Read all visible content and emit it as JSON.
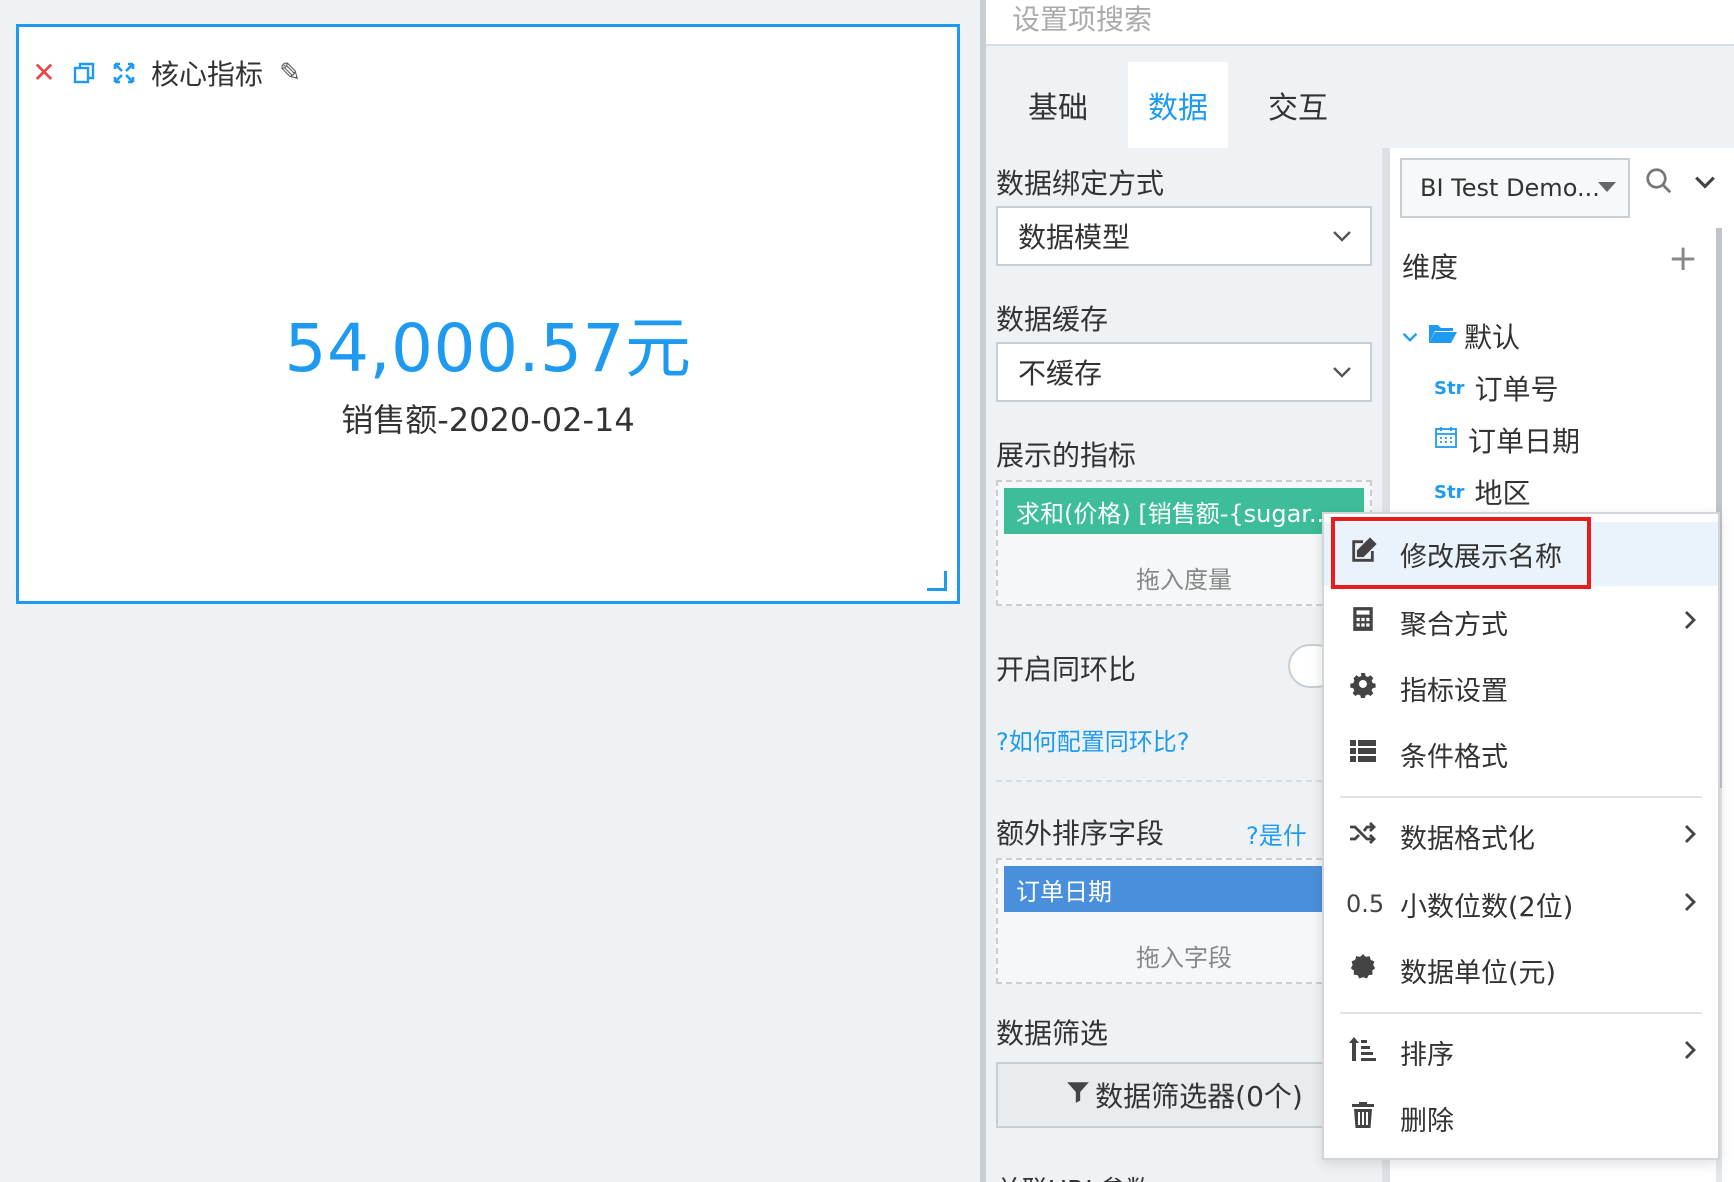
{
  "widget": {
    "title": "核心指标",
    "kpi_value": "54,000.57元",
    "kpi_label": "销售额-2020-02-14"
  },
  "panel": {
    "search_placeholder": "设置项搜索",
    "tabs": [
      {
        "label": "基础",
        "active": false
      },
      {
        "label": "数据",
        "active": true
      },
      {
        "label": "交互",
        "active": false
      }
    ],
    "binding_mode": {
      "label": "数据绑定方式",
      "value": "数据模型"
    },
    "cache": {
      "label": "数据缓存",
      "value": "不缓存"
    },
    "metrics": {
      "label": "展示的指标",
      "chip": "求和(价格) [销售额-{sugar...",
      "hint": "拖入度量"
    },
    "yoy": {
      "label": "开启同环比",
      "help": "?如何配置同环比?"
    },
    "extra_sort": {
      "label": "额外排序字段",
      "help": "?是什",
      "chip": "订单日期",
      "hint": "拖入字段"
    },
    "filter": {
      "label": "数据筛选",
      "button": "数据筛选器(0个)"
    },
    "cutoff_label": "关联URL参数"
  },
  "model_tree": {
    "model_select": "BI Test Demo...",
    "dimension_label": "维度",
    "folder": "默认",
    "fields": [
      {
        "type": "Str",
        "name": "订单号"
      },
      {
        "type": "date",
        "name": "订单日期"
      },
      {
        "type": "Str",
        "name": "地区"
      }
    ]
  },
  "context_menu": {
    "items": [
      {
        "label": "修改展示名称",
        "icon": "edit-icon",
        "arrow": false
      },
      {
        "label": "聚合方式",
        "icon": "calculator-icon",
        "arrow": true
      },
      {
        "label": "指标设置",
        "icon": "gear-icon",
        "arrow": false
      },
      {
        "label": "条件格式",
        "icon": "list-icon",
        "arrow": false
      },
      {
        "label": "数据格式化",
        "icon": "shuffle-icon",
        "arrow": true
      },
      {
        "label": "小数位数(2位)",
        "icon": "decimal-icon",
        "icon_text": "0.5",
        "arrow": true
      },
      {
        "label": "数据单位(元)",
        "icon": "badge-icon",
        "arrow": false
      },
      {
        "label": "排序",
        "icon": "sort-icon",
        "arrow": true
      },
      {
        "label": "删除",
        "icon": "trash-icon",
        "arrow": false
      }
    ]
  },
  "colors": {
    "accent": "#1e9bf0",
    "chip_green": "#3dbd99",
    "chip_blue": "#4a8fdb",
    "highlight_red": "#e81c1c"
  }
}
